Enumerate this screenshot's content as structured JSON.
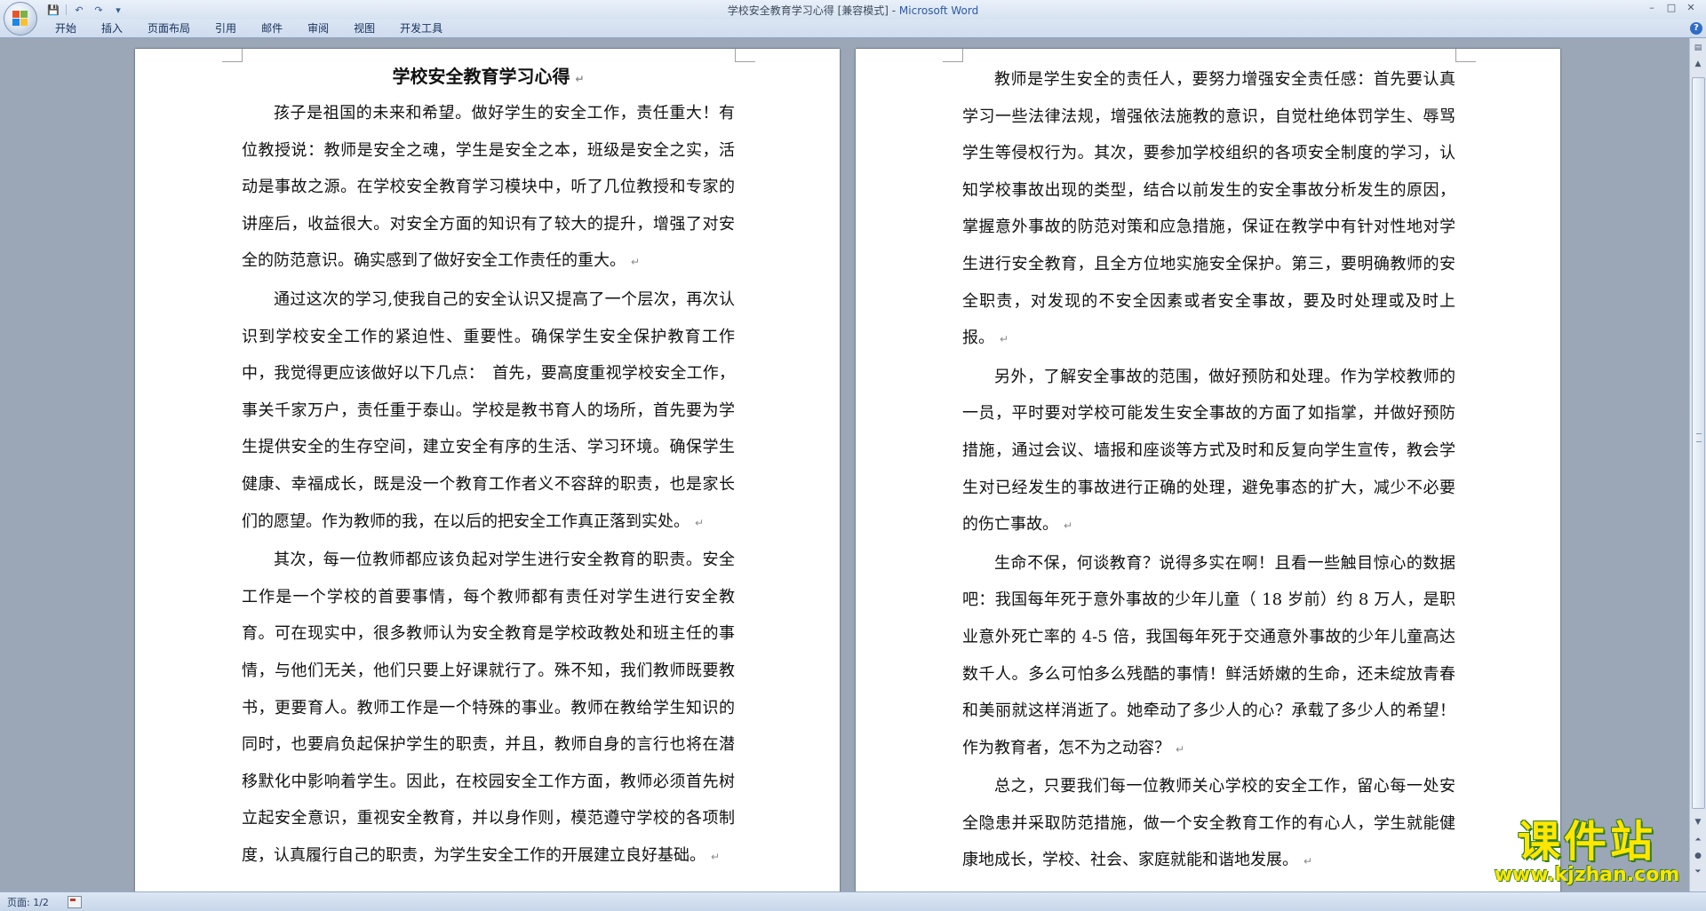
{
  "window": {
    "title_doc": "学校安全教育学习心得 [兼容模式] - ",
    "title_app": "Microsoft Word",
    "controls": [
      "–",
      "□",
      "✕"
    ]
  },
  "ribbon": {
    "tabs": [
      "开始",
      "插入",
      "页面布局",
      "引用",
      "邮件",
      "审阅",
      "视图",
      "开发工具"
    ],
    "help": "?"
  },
  "quick_access": {
    "save": "💾",
    "undo": "↶",
    "redo": "↷",
    "more": "▾"
  },
  "document": {
    "title": "学校安全教育学习心得",
    "left_page": [
      "孩子是祖国的未来和希望。做好学生的安全工作，责任重大！有位教授说：教师是安全之魂，学生是安全之本，班级是安全之实，活动是事故之源。在学校安全教育学习模块中，听了几位教授和专家的讲座后，收益很大。对安全方面的知识有了较大的提升，增强了对安全的防范意识。确实感到了做好安全工作责任的重大。",
      "通过这次的学习,使我自己的安全认识又提高了一个层次，再次认识到学校安全工作的紧迫性、重要性。确保学生安全保护教育工作中，我觉得更应该做好以下几点：　首先，要高度重视学校安全工作，事关千家万户，责任重于泰山。学校是教书育人的场所，首先要为学生提供安全的生存空间，建立安全有序的生活、学习环境。确保学生健康、幸福成长，既是没一个教育工作者义不容辞的职责，也是家长们的愿望。作为教师的我，在以后的把安全工作真正落到实处。",
      "其次，每一位教师都应该负起对学生进行安全教育的职责。安全工作是一个学校的首要事情，每个教师都有责任对学生进行安全教育。可在现实中，很多教师认为安全教育是学校政教处和班主任的事情，与他们无关，他们只要上好课就行了。殊不知，我们教师既要教书，更要育人。教师工作是一个特殊的事业。教师在教给学生知识的同时，也要肩负起保护学生的职责，并且，教师自身的言行也将在潜移默化中影响着学生。因此，在校园安全工作方面，教师必须首先树立起安全意识，重视安全教育，并以身作则，模范遵守学校的各项制度，认真履行自己的职责，为学生安全工作的开展建立良好基础。"
    ],
    "right_page": [
      "教师是学生安全的责任人，要努力增强安全责任感：首先要认真学习一些法律法规，增强依法施教的意识，自觉杜绝体罚学生、辱骂学生等侵权行为。其次，要参加学校组织的各项安全制度的学习，认知学校事故出现的类型，结合以前发生的安全事故分析发生的原因，掌握意外事故的防范对策和应急措施，保证在教学中有针对性地对学生进行安全教育，且全方位地实施安全保护。第三，要明确教师的安全职责，对发现的不安全因素或者安全事故，要及时处理或及时上报。",
      "另外，了解安全事故的范围，做好预防和处理。作为学校教师的一员，平时要对学校可能发生安全事故的方面了如指掌，并做好预防措施，通过会议、墙报和座谈等方式及时和反复向学生宣传，教会学生对已经发生的事故进行正确的处理，避免事态的扩大，减少不必要的伤亡事故。",
      "生命不保，何谈教育？说得多实在啊！且看一些触目惊心的数据吧：我国每年死于意外事故的少年儿童（ 18 岁前）约 8 万人，是职业意外死亡率的 4-5 倍，我国每年死于交通意外事故的少年儿童高达数千人。多么可怕多么残酷的事情！鲜活娇嫩的生命，还未绽放青春和美丽就这样消逝了。她牵动了多少人的心？承载了多少人的希望！作为教育者，怎不为之动容？",
      "总之，只要我们每一位教师关心学校的安全工作，留心每一处安全隐患并采取防范措施，做一个安全教育工作的有心人，学生就能健康地成长，学校、社会、家庭就能和谐地发展。"
    ],
    "paragraph_mark": "↵"
  },
  "statusbar": {
    "page": "页面: 1/2"
  },
  "watermark": {
    "brand": "课件站",
    "url": "www.kjzhan.com"
  },
  "colors": {
    "workspace": "#9ba6b7",
    "ribbon": "#dbe6f4",
    "title_app": "#2b5aa8",
    "watermark": "#ffe600"
  }
}
